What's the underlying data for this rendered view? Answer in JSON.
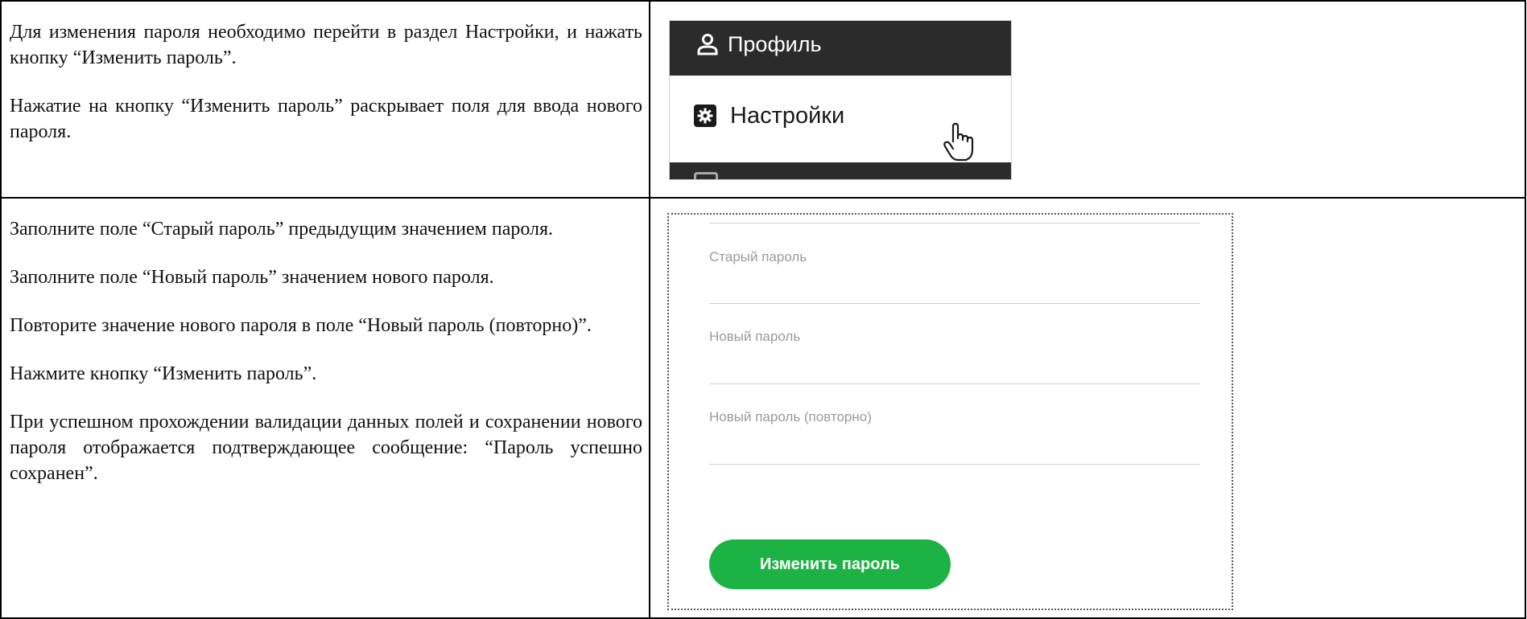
{
  "rows": [
    {
      "paragraphs": [
        "Для изменения пароля необходимо перейти в раздел Настройки, и нажать кнопку “Изменить пароль”.",
        "Нажатие на кнопку “Изменить пароль” раскрывает поля для ввода нового пароля."
      ],
      "screenshot": {
        "menu": {
          "profile_label": "Профиль",
          "profile_icon": "user-icon",
          "settings_label": "Настройки",
          "settings_icon": "gear-icon",
          "cursor_icon": "hand-pointer-icon"
        },
        "colors": {
          "menu_dark": "#2b2b2b",
          "menu_light": "#ffffff"
        }
      }
    },
    {
      "paragraphs": [
        "Заполните поле “Старый пароль” предыдущим значением пароля.",
        "Заполните поле “Новый пароль” значением нового пароля.",
        "Повторите значение нового пароля в поле “Новый пароль (повторно)”.",
        "Нажмите кнопку “Изменить пароль”.",
        "При успешном прохождении валидации данных полей и сохранении нового пароля отображается подтверждающее сообщение: “Пароль успешно сохранен”."
      ],
      "screenshot": {
        "form": {
          "old_password_label": "Старый пароль",
          "new_password_label": "Новый пароль",
          "repeat_password_label": "Новый пароль (повторно)",
          "submit_label": "Изменить пароль"
        },
        "colors": {
          "button": "#1db344",
          "label": "#9a9a9a",
          "line": "#cfcfcf"
        }
      }
    }
  ]
}
